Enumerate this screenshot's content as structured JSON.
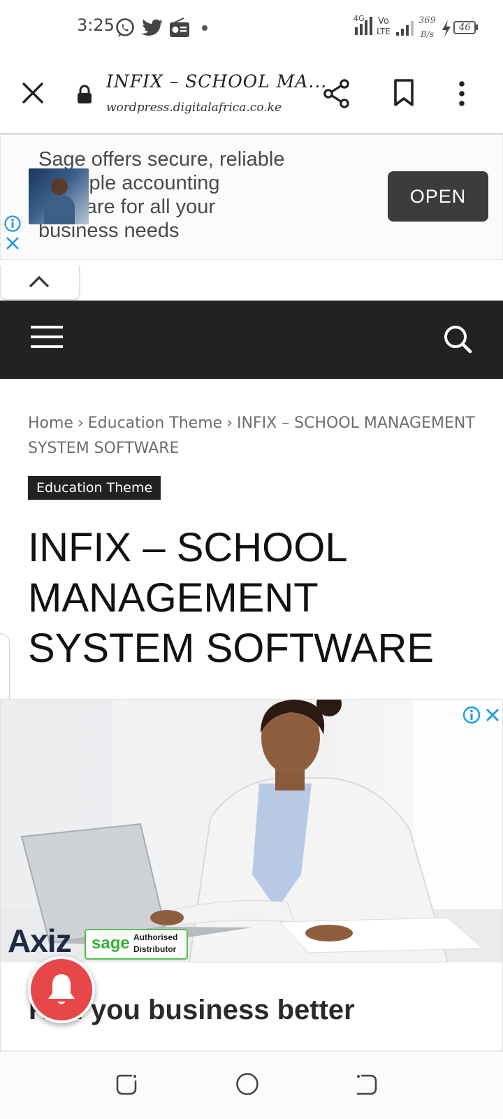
{
  "status_bar": {
    "time": "3:25",
    "network_type": "4G",
    "volte_top": "Vo",
    "volte_bottom": "LTE",
    "speed_value": "369",
    "speed_unit": "B/s",
    "battery_level": "46",
    "icons": [
      "whatsapp-icon",
      "twitter-icon",
      "radio-icon",
      "dot-icon",
      "signal-icon",
      "charging-icon",
      "battery-icon"
    ]
  },
  "browser": {
    "page_title": "INFIX – SCHOOL MA...",
    "url": "wordpress.digitalafrica.co.ke",
    "icons": [
      "close-icon",
      "lock-icon",
      "share-icon",
      "bookmark-icon",
      "more-vertical-icon"
    ]
  },
  "top_ad": {
    "text": "Sage offers secure, reliable & simple accounting software for all your business needs",
    "button_label": "OPEN",
    "icons": [
      "ad-info-icon",
      "ad-close-icon",
      "chevron-up-icon"
    ]
  },
  "site_nav": {
    "icons": [
      "hamburger-menu-icon",
      "search-icon"
    ]
  },
  "article": {
    "breadcrumb": {
      "home": "Home",
      "separator": "›",
      "category": "Education Theme",
      "current": "INFIX – SCHOOL MANAGEMENT SYSTEM SOFTWARE"
    },
    "category_badge": "Education Theme",
    "title": "INFIX – SCHOOL MANAGEMENT SYSTEM SOFTWARE"
  },
  "image_ad": {
    "brand_logo": "Axiz",
    "partner_logo": "sage",
    "partner_sub_top": "Authorised",
    "partner_sub_bottom": "Distributor",
    "headline": "Run you business better"
  },
  "colors": {
    "nav_bg": "#222222",
    "open_button_bg": "#3c3c3c",
    "bell_bg": "#e8474a",
    "adchoices_blue": "#1a9be8",
    "sage_green": "#37b233"
  },
  "system_nav": {
    "icons": [
      "recents-icon",
      "home-circle-icon",
      "back-icon"
    ]
  }
}
